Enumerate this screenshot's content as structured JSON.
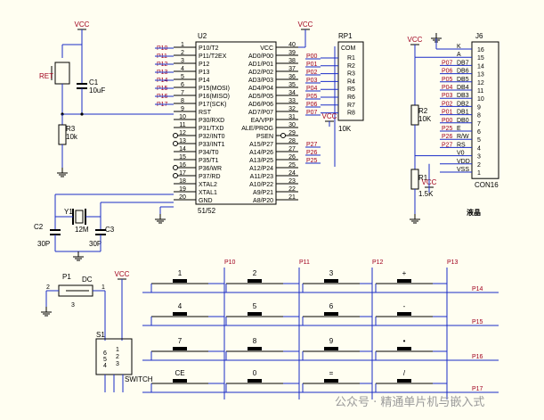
{
  "colors": {
    "wire": "#1a2cc8",
    "component": "#000000",
    "net_label": "#a0001e",
    "background": "#fffef1"
  },
  "power": {
    "vcc": "VCC"
  },
  "mcu": {
    "ref": "U2",
    "part": "51/52",
    "left_pins": [
      {
        "num": "1",
        "name": "P10/T2",
        "net": "P10"
      },
      {
        "num": "2",
        "name": "P11/T2EX",
        "net": "P11"
      },
      {
        "num": "3",
        "name": "P12",
        "net": "P12"
      },
      {
        "num": "4",
        "name": "P13",
        "net": "P13"
      },
      {
        "num": "5",
        "name": "P14",
        "net": "P14"
      },
      {
        "num": "6",
        "name": "P15(MOSI)",
        "net": "P15"
      },
      {
        "num": "7",
        "name": "P16(MISO)",
        "net": "P16"
      },
      {
        "num": "8",
        "name": "P17(SCK)",
        "net": "P17"
      },
      {
        "num": "9",
        "name": "RST",
        "net": ""
      },
      {
        "num": "10",
        "name": "P30/RXD",
        "net": ""
      },
      {
        "num": "11",
        "name": "P31/TXD",
        "net": ""
      },
      {
        "num": "12",
        "name": "P32/INT0",
        "net": ""
      },
      {
        "num": "13",
        "name": "P33/INT1",
        "net": ""
      },
      {
        "num": "14",
        "name": "P34/T0",
        "net": ""
      },
      {
        "num": "15",
        "name": "P35/T1",
        "net": ""
      },
      {
        "num": "16",
        "name": "P36/WR",
        "net": ""
      },
      {
        "num": "17",
        "name": "P37/RD",
        "net": ""
      },
      {
        "num": "18",
        "name": "XTAL2",
        "net": ""
      },
      {
        "num": "19",
        "name": "XTAL1",
        "net": ""
      },
      {
        "num": "20",
        "name": "GND",
        "net": ""
      }
    ],
    "right_pins": [
      {
        "num": "40",
        "name": "VCC",
        "net": ""
      },
      {
        "num": "39",
        "name": "AD0/P00",
        "net": "P00"
      },
      {
        "num": "38",
        "name": "AD1/P01",
        "net": "P01"
      },
      {
        "num": "37",
        "name": "AD2/P02",
        "net": "P02"
      },
      {
        "num": "36",
        "name": "AD3/P03",
        "net": "P03"
      },
      {
        "num": "35",
        "name": "AD4/P04",
        "net": "P04"
      },
      {
        "num": "34",
        "name": "AD5/P05",
        "net": "P05"
      },
      {
        "num": "33",
        "name": "AD6/P06",
        "net": "P06"
      },
      {
        "num": "32",
        "name": "AD7/P07",
        "net": "P07"
      },
      {
        "num": "31",
        "name": "EA/VPP",
        "net": ""
      },
      {
        "num": "30",
        "name": "ALE/PROG",
        "net": ""
      },
      {
        "num": "29",
        "name": "PSEN",
        "net": ""
      },
      {
        "num": "28",
        "name": "A15/P27",
        "net": "P27"
      },
      {
        "num": "27",
        "name": "A14/P26",
        "net": "P26"
      },
      {
        "num": "26",
        "name": "A13/P25",
        "net": "P25"
      },
      {
        "num": "25",
        "name": "A12/P24",
        "net": ""
      },
      {
        "num": "24",
        "name": "A11/P23",
        "net": ""
      },
      {
        "num": "23",
        "name": "A10/P22",
        "net": ""
      },
      {
        "num": "22",
        "name": "A9/P21",
        "net": ""
      },
      {
        "num": "21",
        "name": "A8/P20",
        "net": ""
      }
    ]
  },
  "reset": {
    "button": "RET",
    "cap_ref": "C1",
    "cap_val": "10uF",
    "res_ref": "R3",
    "res_val": "10k"
  },
  "crystal": {
    "ref": "Y1",
    "val": "12M",
    "c2_ref": "C2",
    "c2_val": "30P",
    "c3_ref": "C3",
    "c3_val": "30P"
  },
  "rp1": {
    "ref": "RP1",
    "val": "10K",
    "com": "COM",
    "pins": [
      "R1",
      "R2",
      "R3",
      "R4",
      "R5",
      "R6",
      "R7",
      "R8"
    ]
  },
  "lcd": {
    "ref": "J6",
    "part": "CON16",
    "title": "液晶",
    "pins": [
      {
        "num": "16",
        "sig": "K",
        "net": ""
      },
      {
        "num": "15",
        "sig": "A",
        "net": ""
      },
      {
        "num": "14",
        "sig": "DB7",
        "net": "P07"
      },
      {
        "num": "13",
        "sig": "DB6",
        "net": "P06"
      },
      {
        "num": "12",
        "sig": "DB5",
        "net": "P05"
      },
      {
        "num": "11",
        "sig": "DB4",
        "net": "P04"
      },
      {
        "num": "10",
        "sig": "DB3",
        "net": "P03"
      },
      {
        "num": "9",
        "sig": "DB2",
        "net": "P02"
      },
      {
        "num": "8",
        "sig": "DB1",
        "net": "P01"
      },
      {
        "num": "7",
        "sig": "DB0",
        "net": "P00"
      },
      {
        "num": "6",
        "sig": "E",
        "net": "P25"
      },
      {
        "num": "5",
        "sig": "R/W",
        "net": "P26"
      },
      {
        "num": "4",
        "sig": "RS",
        "net": "P27"
      },
      {
        "num": "3",
        "sig": "V0",
        "net": ""
      },
      {
        "num": "2",
        "sig": "VDD",
        "net": ""
      },
      {
        "num": "1",
        "sig": "VSS",
        "net": ""
      }
    ],
    "r2_ref": "R2",
    "r2_val": "10K",
    "r1_ref": "R1",
    "r1_val": "1.5K"
  },
  "power_in": {
    "jack_ref": "P1",
    "jack_label": "DC",
    "pin1": "1",
    "pin2": "2",
    "pin3": "3",
    "switch_ref": "S1",
    "switch_label": "SWITCH",
    "sw_pins": [
      "1",
      "2",
      "3",
      "4",
      "5",
      "6"
    ]
  },
  "keypad": {
    "col_nets": [
      "P10",
      "P11",
      "P12",
      "P13"
    ],
    "row_nets": [
      "P14",
      "P15",
      "P16",
      "P17"
    ],
    "keys": [
      [
        "1",
        "2",
        "3",
        "+"
      ],
      [
        "4",
        "5",
        "6",
        "-"
      ],
      [
        "7",
        "8",
        "9",
        "•"
      ],
      [
        "CE",
        "0",
        "=",
        "/"
      ]
    ]
  },
  "watermark": "公众号 · 精通单片机与嵌入式"
}
